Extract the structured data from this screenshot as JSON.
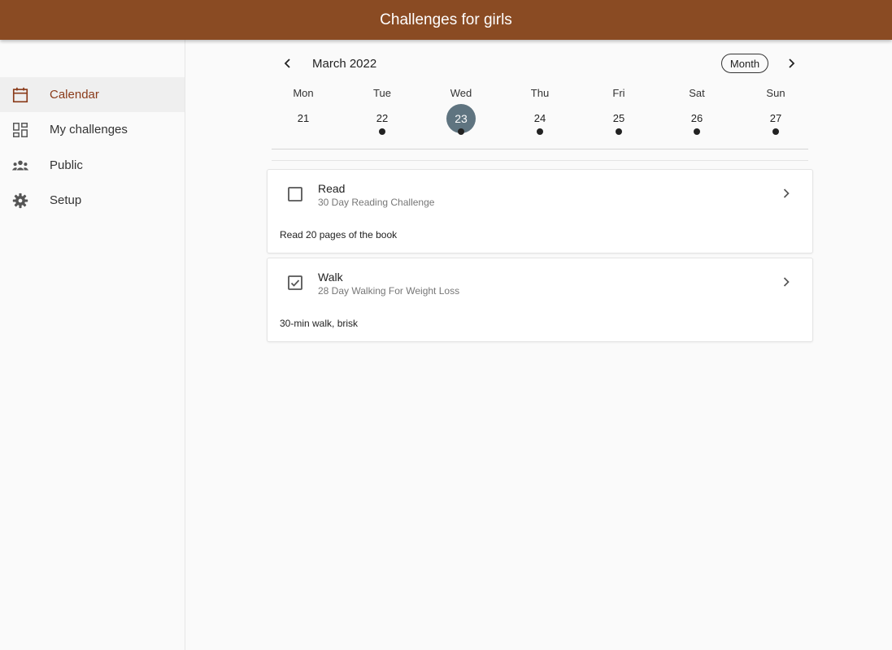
{
  "app": {
    "title": "Challenges for girls"
  },
  "sidebar": {
    "items": [
      {
        "label": "Calendar",
        "icon": "calendar-icon",
        "active": true
      },
      {
        "label": "My challenges",
        "icon": "dashboard-icon",
        "active": false
      },
      {
        "label": "Public",
        "icon": "groups-icon",
        "active": false
      },
      {
        "label": "Setup",
        "icon": "gear-icon",
        "active": false
      }
    ]
  },
  "calendar": {
    "month_label": "March 2022",
    "view_button": "Month",
    "days": [
      {
        "dow": "Mon",
        "date": "21",
        "has_event": false,
        "selected": false
      },
      {
        "dow": "Tue",
        "date": "22",
        "has_event": true,
        "selected": false
      },
      {
        "dow": "Wed",
        "date": "23",
        "has_event": true,
        "selected": true
      },
      {
        "dow": "Thu",
        "date": "24",
        "has_event": true,
        "selected": false
      },
      {
        "dow": "Fri",
        "date": "25",
        "has_event": true,
        "selected": false
      },
      {
        "dow": "Sat",
        "date": "26",
        "has_event": true,
        "selected": false
      },
      {
        "dow": "Sun",
        "date": "27",
        "has_event": true,
        "selected": false
      }
    ]
  },
  "challenges": [
    {
      "name": "Read",
      "subtitle": "30 Day Reading Challenge",
      "description": "Read 20 pages of the book",
      "checked": false
    },
    {
      "name": "Walk",
      "subtitle": "28 Day Walking For Weight Loss",
      "description": "30-min walk, brisk",
      "checked": true
    }
  ],
  "colors": {
    "appbar": "#8a4b23",
    "active_nav_text": "#8a3b1a",
    "selected_day": "#5f7480"
  }
}
